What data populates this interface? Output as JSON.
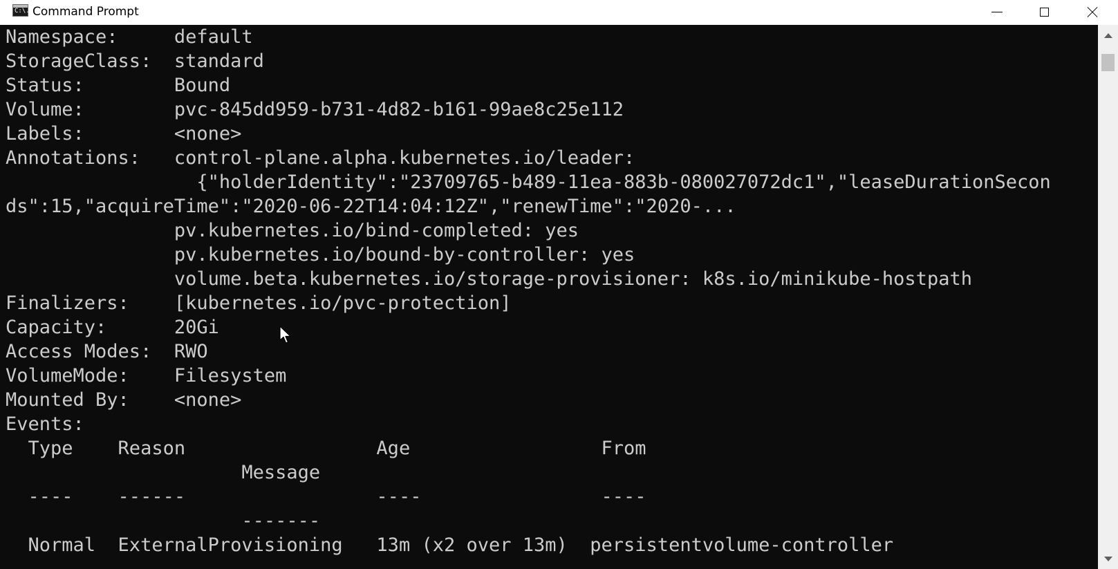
{
  "window": {
    "title": "Command Prompt",
    "icon": "cmd-icon",
    "icon_text": "C:\\.",
    "controls": [
      "minimize-icon",
      "maximize-icon",
      "close-icon"
    ]
  },
  "console": {
    "lines": [
      "Namespace:     default",
      "StorageClass:  standard",
      "Status:        Bound",
      "Volume:        pvc-845dd959-b731-4d82-b161-99ae8c25e112",
      "Labels:        <none>",
      "Annotations:   control-plane.alpha.kubernetes.io/leader:",
      "                 {\"holderIdentity\":\"23709765-b489-11ea-883b-080027072dc1\",\"leaseDurationSecon",
      "ds\":15,\"acquireTime\":\"2020-06-22T14:04:12Z\",\"renewTime\":\"2020-...",
      "               pv.kubernetes.io/bind-completed: yes",
      "               pv.kubernetes.io/bound-by-controller: yes",
      "               volume.beta.kubernetes.io/storage-provisioner: k8s.io/minikube-hostpath",
      "Finalizers:    [kubernetes.io/pvc-protection]",
      "Capacity:      20Gi",
      "Access Modes:  RWO",
      "VolumeMode:    Filesystem",
      "Mounted By:    <none>",
      "Events:",
      "  Type    Reason                 Age                 From",
      "                     Message",
      "  ----    ------                 ----                ----",
      "                     -------",
      "  Normal  ExternalProvisioning   13m (x2 over 13m)  persistentvolume-controller"
    ]
  },
  "colors": {
    "console_background": "#0c0c0c",
    "console_text": "#cccccc",
    "titlebar_background": "#ffffff",
    "scrollbar_track": "#f0f0f0",
    "scrollbar_thumb": "#c2c2c2"
  }
}
